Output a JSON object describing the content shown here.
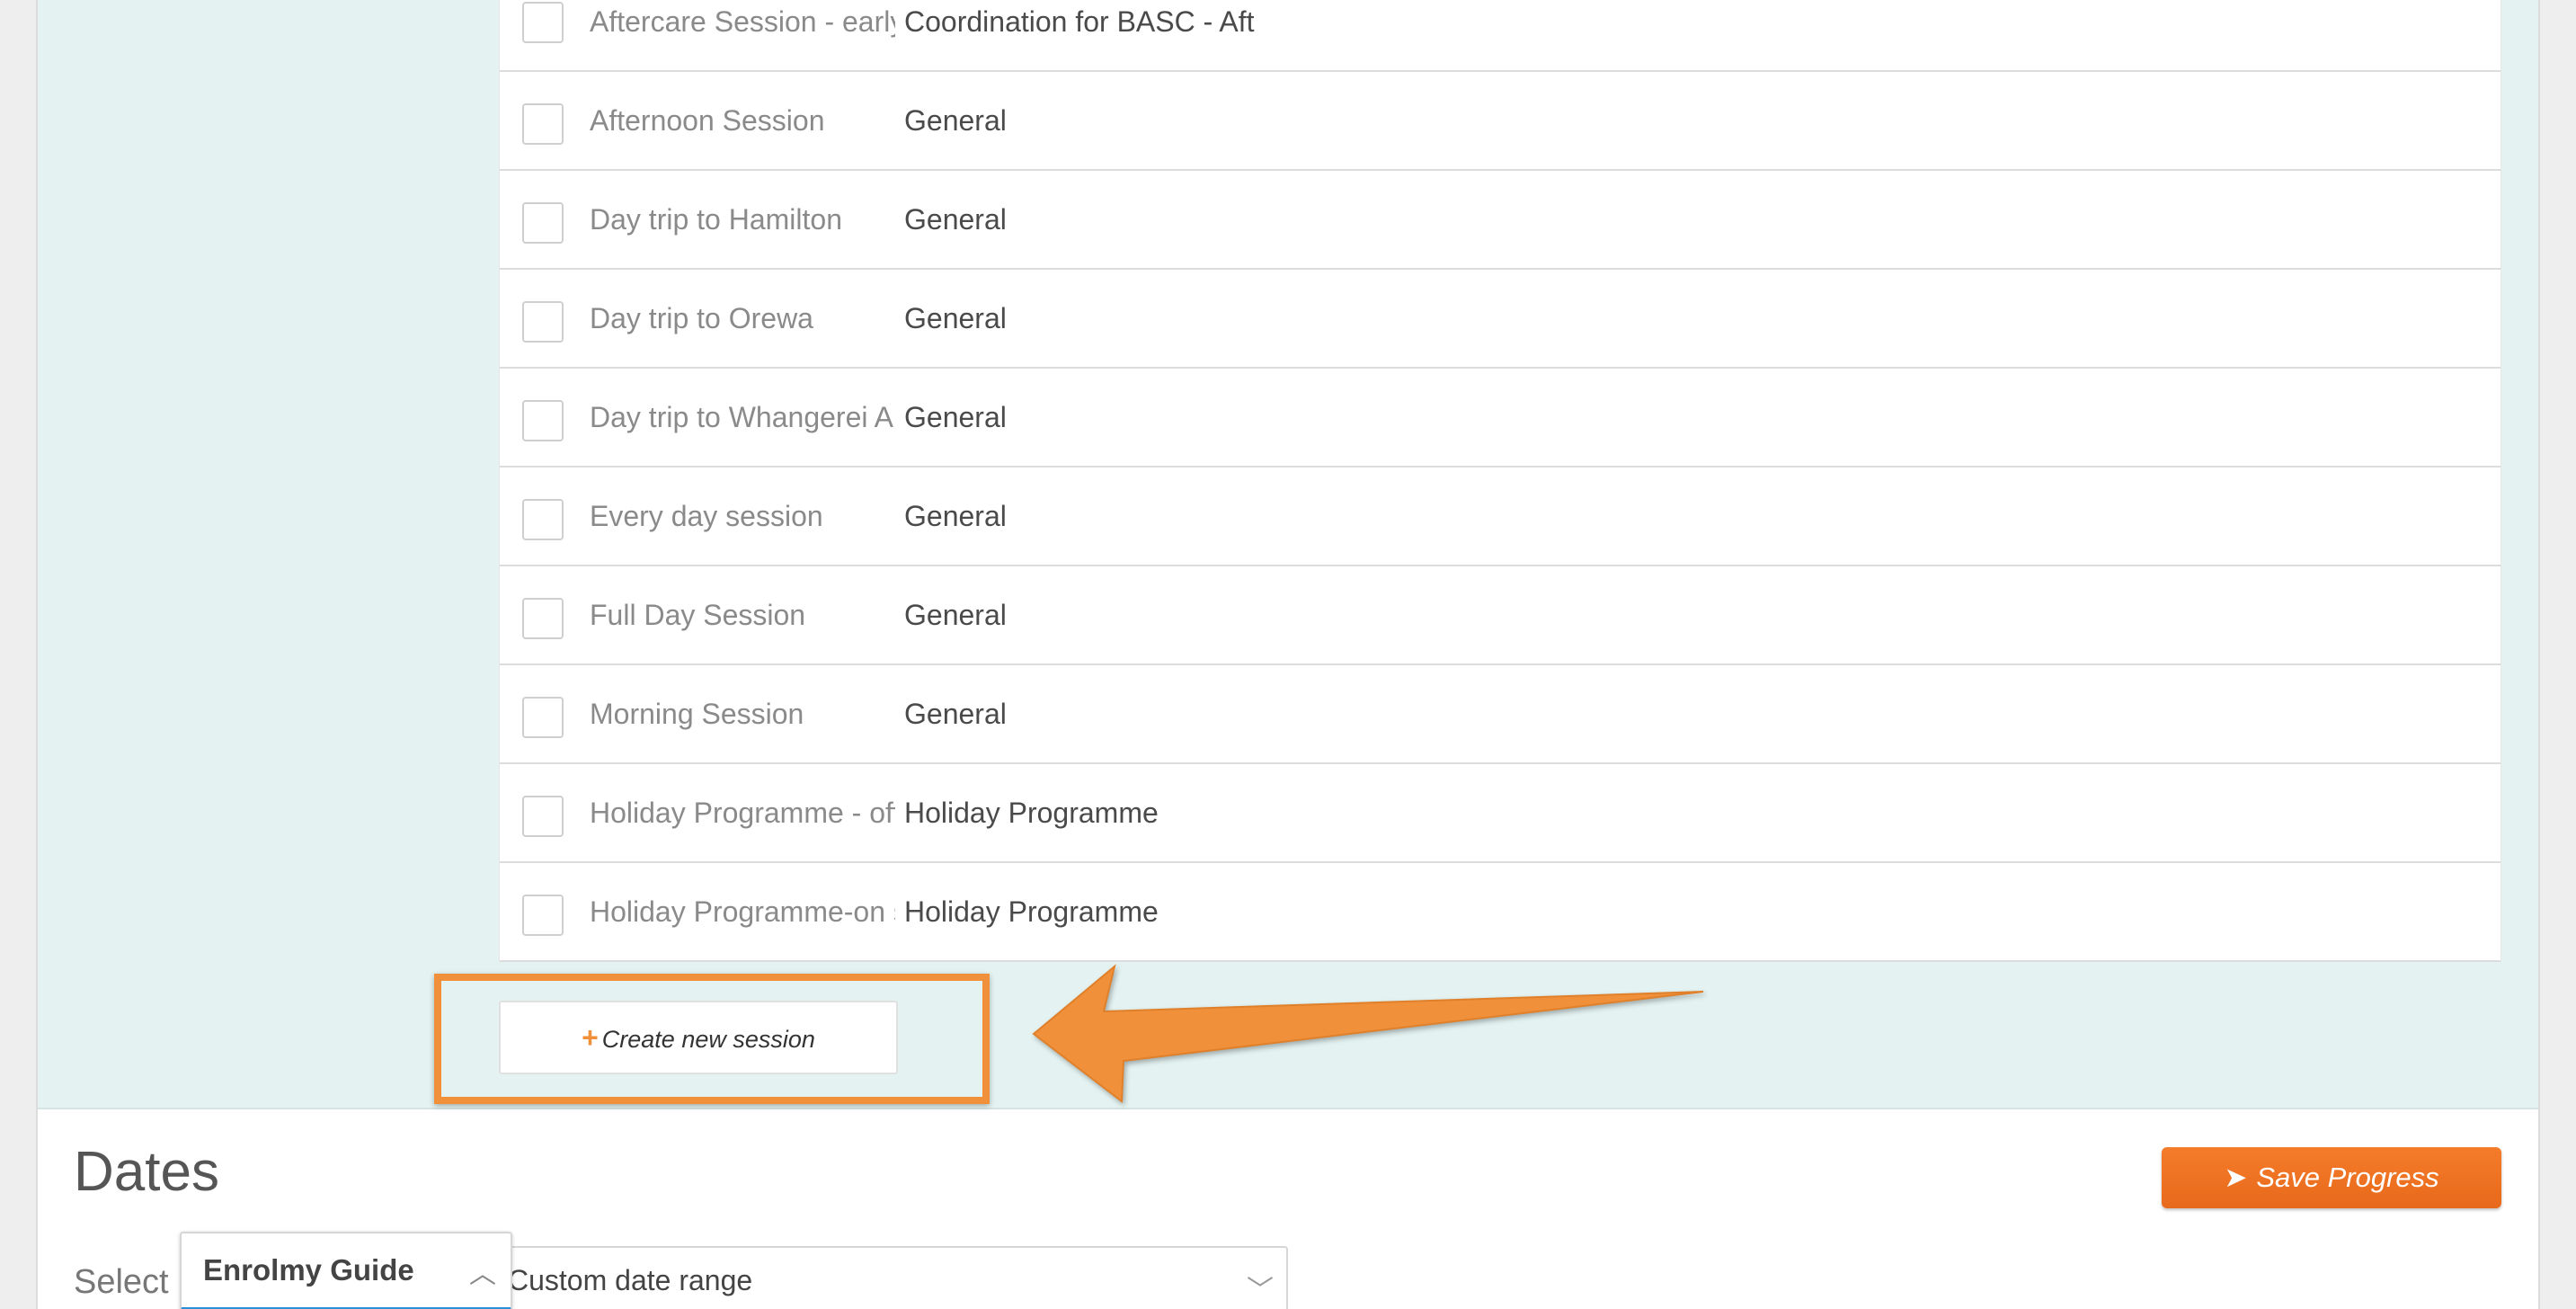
{
  "sessions": [
    {
      "name": "Aftercare Session - early",
      "category": "Coordination for BASC - Aft"
    },
    {
      "name": "Afternoon Session",
      "category": "General"
    },
    {
      "name": "Day trip to Hamilton",
      "category": "General"
    },
    {
      "name": "Day trip to Orewa",
      "category": "General"
    },
    {
      "name": "Day trip to Whangerei A",
      "category": "General"
    },
    {
      "name": "Every day session",
      "category": "General"
    },
    {
      "name": "Full Day Session",
      "category": "General"
    },
    {
      "name": "Morning Session",
      "category": "General"
    },
    {
      "name": "Holiday Programme - off",
      "category": "Holiday Programme"
    },
    {
      "name": "Holiday Programme-on s",
      "category": "Holiday Programme"
    }
  ],
  "create_button": {
    "label": "Create new session"
  },
  "dates": {
    "title": "Dates",
    "save_label": "Save Progress",
    "select_label": "Select I",
    "date_range_value": "Custom date range"
  },
  "guide": {
    "title": "Enrolmy Guide"
  },
  "colors": {
    "accent": "#f0903a",
    "teal_bg": "#e4f3f2",
    "save": "#ec6f1f",
    "guide_underline": "#2b8fd6"
  }
}
